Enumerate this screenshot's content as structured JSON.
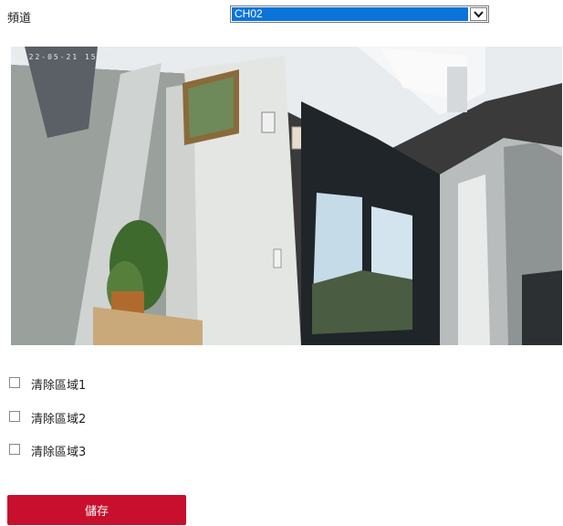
{
  "channel": {
    "label": "頻道",
    "selected": "CH02"
  },
  "video": {
    "osd_timestamp": "2022-05-21 15:39:13"
  },
  "regions": [
    {
      "label": "清除區域1",
      "checked": false
    },
    {
      "label": "清除區域2",
      "checked": false
    },
    {
      "label": "清除區域3",
      "checked": false
    }
  ],
  "actions": {
    "save_label": "儲存"
  },
  "colors": {
    "accent": "#c8102e",
    "select_highlight": "#0a74da"
  }
}
